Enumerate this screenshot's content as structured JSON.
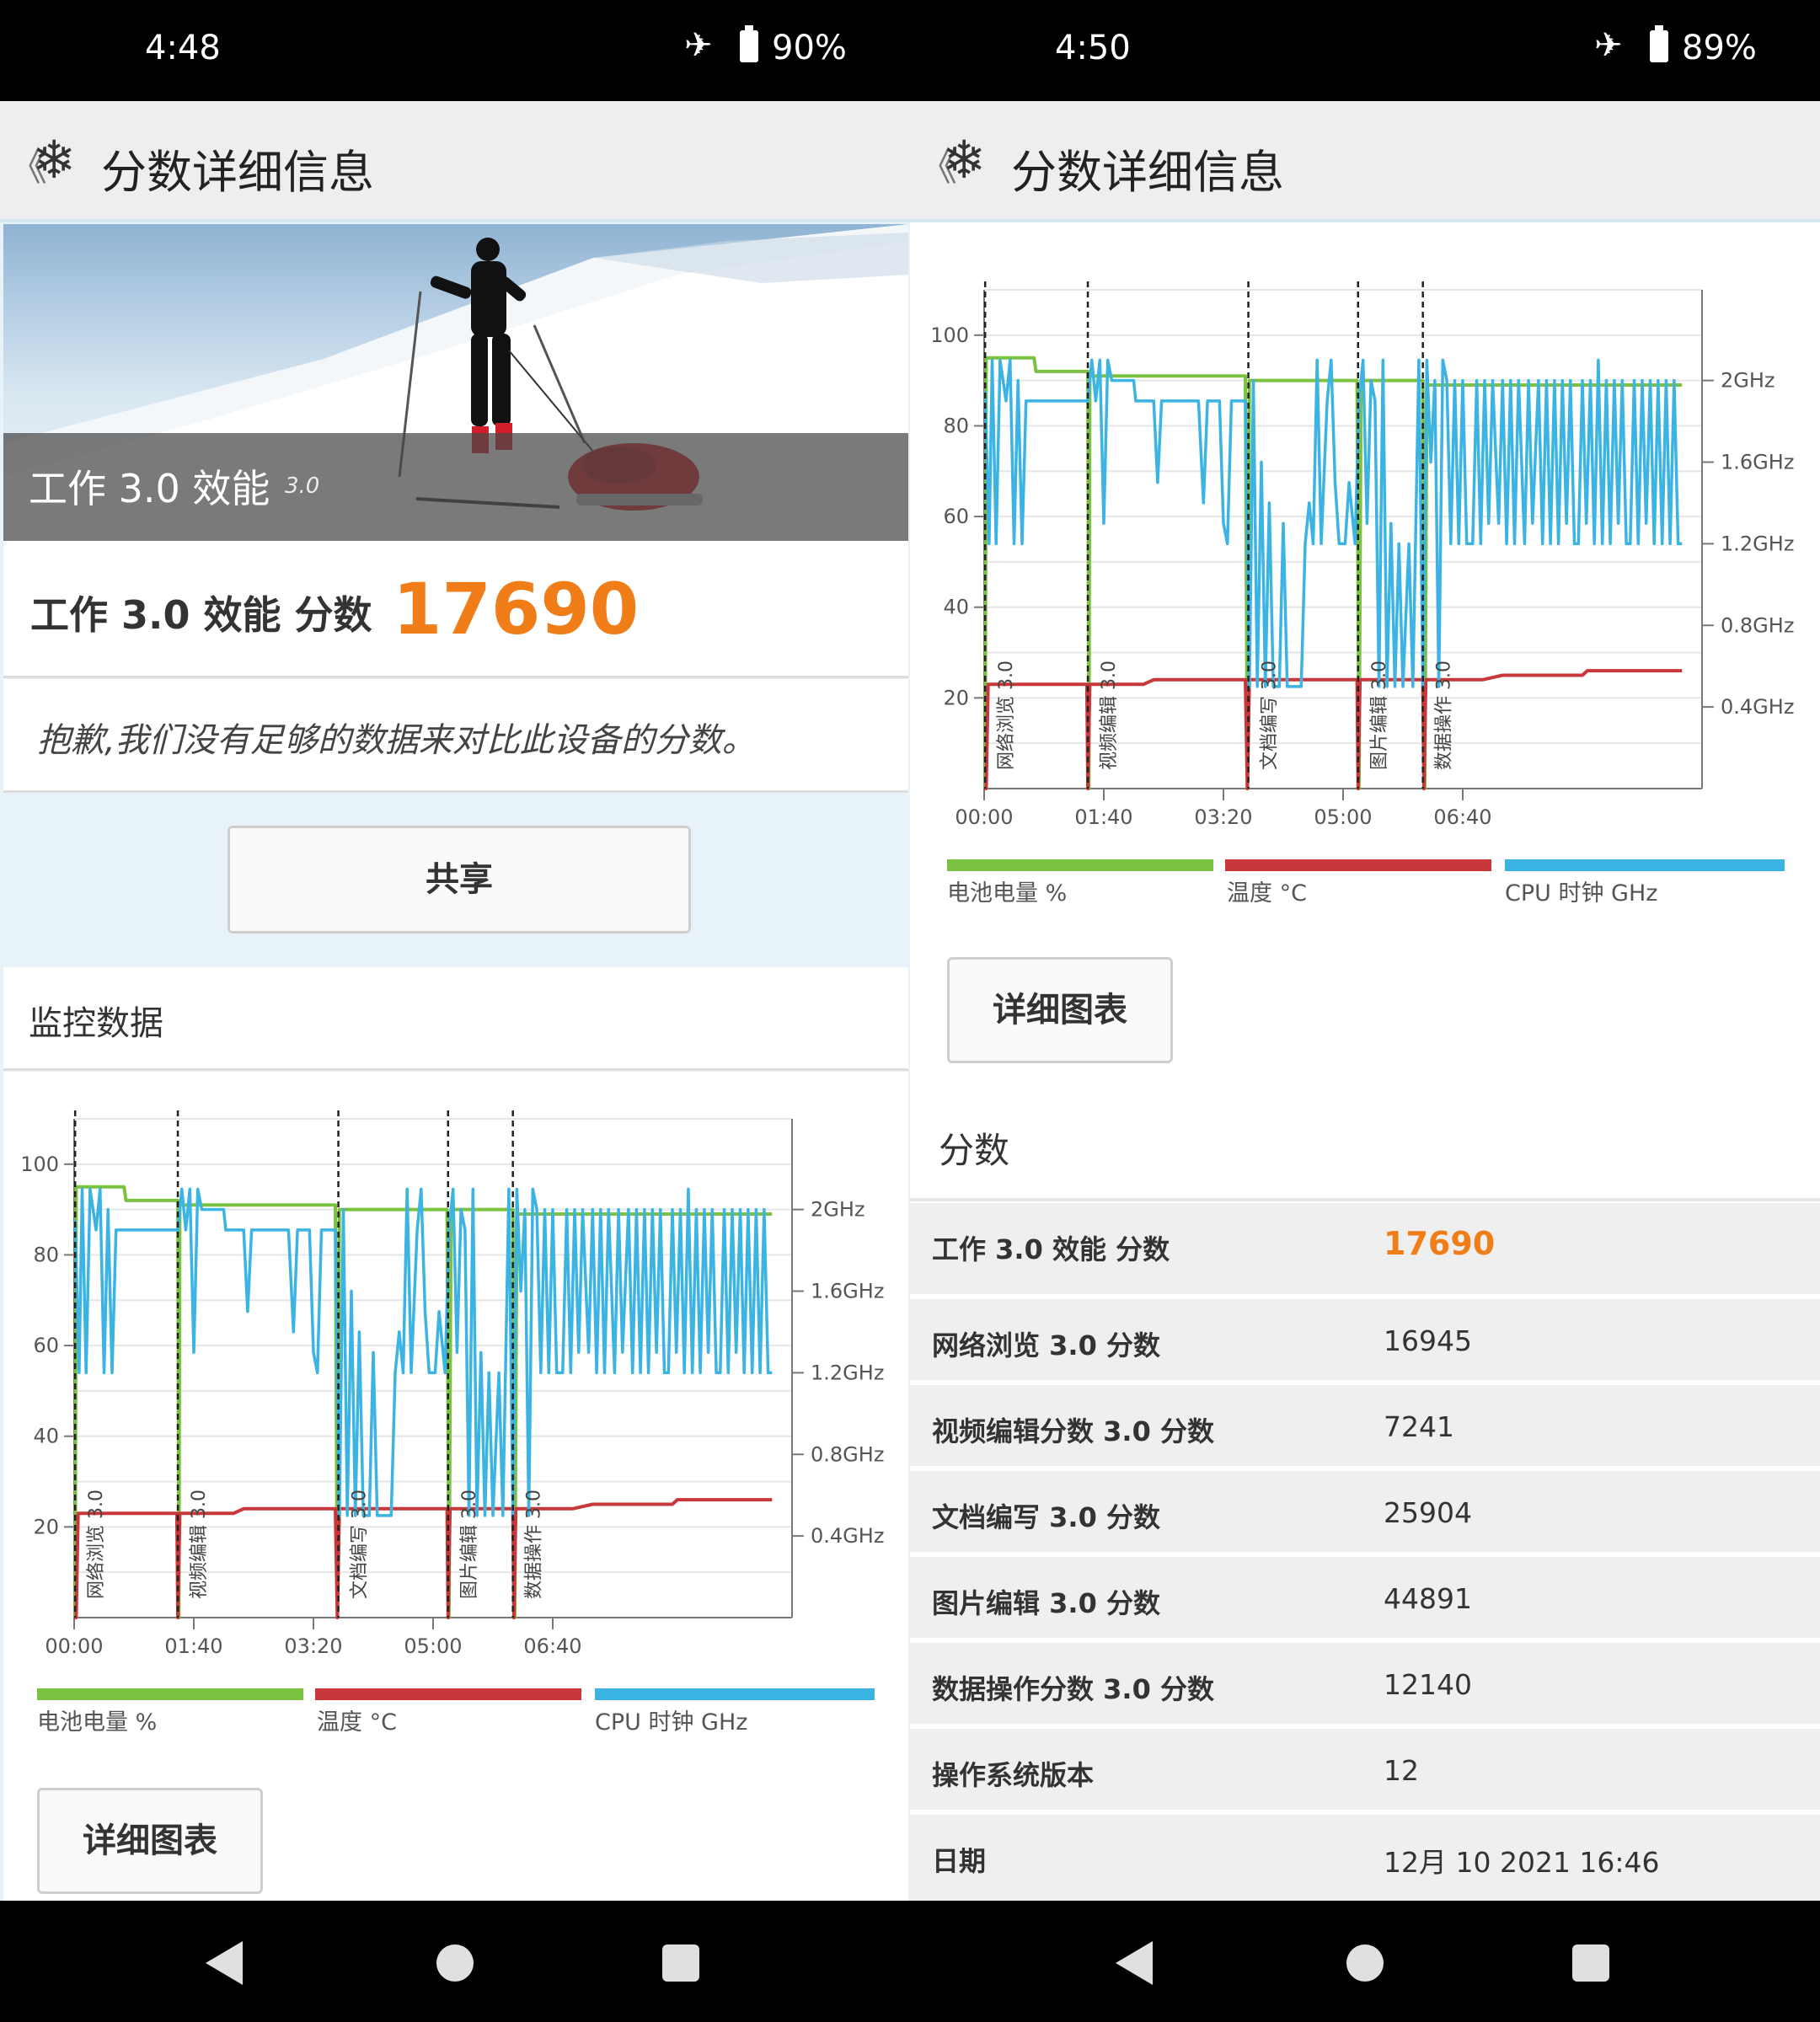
{
  "left": {
    "status": {
      "time": "4:48",
      "battery_pct": "90%"
    },
    "appbar": {
      "back": "《",
      "title": "分数详细信息"
    },
    "hero": {
      "title": "工作 3.0 效能",
      "version": "3.0"
    },
    "score": {
      "label": "工作 3.0 效能 分数",
      "value": "17690"
    },
    "notice": "抱歉,我们没有足够的数据来对比此设备的分数。",
    "share_button": "共享",
    "monitor": {
      "heading": "监控数据"
    },
    "details_button": "详细图表"
  },
  "right": {
    "status": {
      "time": "4:50",
      "battery_pct": "89%"
    },
    "appbar": {
      "back": "《",
      "title": "分数详细信息"
    },
    "details_button": "详细图表",
    "scores_heading": "分数",
    "rows": [
      {
        "label": "工作 3.0 效能 分数",
        "value": "17690"
      },
      {
        "label": "网络浏览 3.0 分数",
        "value": "16945"
      },
      {
        "label": "视频编辑分数 3.0 分数",
        "value": "7241"
      },
      {
        "label": "文档编写 3.0 分数",
        "value": "25904"
      },
      {
        "label": "图片编辑 3.0 分数",
        "value": "44891"
      },
      {
        "label": "数据操作分数 3.0 分数",
        "value": "12140"
      },
      {
        "label": "操作系统版本",
        "value": "12"
      },
      {
        "label": "日期",
        "value": "12月 10 2021 16:46"
      }
    ]
  },
  "colors": {
    "accent": "#f07d18",
    "battery": "#7cc242",
    "temp": "#c8383a",
    "cpu": "#3bb4e3"
  },
  "icons": {
    "logo": "snowflake-icon",
    "airplane": "airplane-icon",
    "battery": "battery-icon"
  },
  "chart_data": {
    "type": "line",
    "x_ticks": [
      "00:00",
      "01:40",
      "03:20",
      "05:00",
      "06:40"
    ],
    "y_ticks_left": [
      "100",
      "80",
      "60",
      "40",
      "20"
    ],
    "y_ticks_right": [
      "2GHz",
      "1.6GHz",
      "1.2GHz",
      "0.8GHz",
      "0.4GHz"
    ],
    "ylim_left": [
      0,
      110
    ],
    "markers": [
      {
        "t": 1,
        "label": "网络浏览 3.0"
      },
      {
        "t": 104,
        "label": "视频编辑 3.0"
      },
      {
        "t": 265,
        "label": "文档编写 3.0"
      },
      {
        "t": 375,
        "label": "图片编辑 3.0"
      },
      {
        "t": 440,
        "label": "数据操作 3.0"
      }
    ],
    "legend": [
      "电池电量 %",
      "温度 °C",
      "CPU 时钟 GHz"
    ],
    "series": [
      {
        "name": "电池电量 %",
        "points": [
          [
            0,
            0
          ],
          [
            1,
            0
          ],
          [
            2,
            95
          ],
          [
            20,
            95
          ],
          [
            50,
            95
          ],
          [
            52,
            92
          ],
          [
            104,
            92
          ],
          [
            105,
            0
          ],
          [
            106,
            91
          ],
          [
            160,
            91
          ],
          [
            262,
            91
          ],
          [
            264,
            0
          ],
          [
            266,
            90
          ],
          [
            300,
            90
          ],
          [
            374,
            90
          ],
          [
            376,
            0
          ],
          [
            378,
            90
          ],
          [
            440,
            90
          ],
          [
            442,
            0
          ],
          [
            444,
            89
          ],
          [
            700,
            89
          ]
        ]
      },
      {
        "name": "温度 °C",
        "points": [
          [
            0,
            0
          ],
          [
            2,
            0
          ],
          [
            4,
            23
          ],
          [
            100,
            23
          ],
          [
            103,
            23
          ],
          [
            104,
            0
          ],
          [
            106,
            23
          ],
          [
            160,
            23
          ],
          [
            170,
            24
          ],
          [
            262,
            24
          ],
          [
            264,
            0
          ],
          [
            266,
            24
          ],
          [
            300,
            24
          ],
          [
            374,
            24
          ],
          [
            375,
            0
          ],
          [
            377,
            24
          ],
          [
            440,
            24
          ],
          [
            441,
            0
          ],
          [
            443,
            24
          ],
          [
            500,
            24
          ],
          [
            520,
            25
          ],
          [
            580,
            25
          ],
          [
            600,
            25
          ],
          [
            605,
            26
          ],
          [
            700,
            26
          ]
        ]
      },
      {
        "name": "CPU 时钟 GHz",
        "points": [
          [
            1,
            1.95
          ],
          [
            5,
            1.2
          ],
          [
            8,
            2.1
          ],
          [
            12,
            1.2
          ],
          [
            16,
            2.1
          ],
          [
            22,
            1.9
          ],
          [
            26,
            2.1
          ],
          [
            30,
            1.2
          ],
          [
            34,
            2.0
          ],
          [
            38,
            1.2
          ],
          [
            42,
            1.9
          ],
          [
            46,
            1.9
          ],
          [
            104,
            1.9
          ],
          [
            108,
            2.1
          ],
          [
            112,
            1.9
          ],
          [
            116,
            2.1
          ],
          [
            120,
            1.3
          ],
          [
            124,
            2.1
          ],
          [
            128,
            2.0
          ],
          [
            150,
            2.0
          ],
          [
            152,
            1.9
          ],
          [
            170,
            1.9
          ],
          [
            174,
            1.5
          ],
          [
            178,
            1.9
          ],
          [
            200,
            1.9
          ],
          [
            215,
            1.9
          ],
          [
            220,
            1.4
          ],
          [
            224,
            1.9
          ],
          [
            236,
            1.9
          ],
          [
            240,
            1.3
          ],
          [
            244,
            1.2
          ],
          [
            248,
            1.9
          ],
          [
            262,
            1.9
          ],
          [
            266,
            0.5
          ],
          [
            270,
            2.0
          ],
          [
            274,
            0.5
          ],
          [
            278,
            1.6
          ],
          [
            282,
            0.5
          ],
          [
            286,
            1.4
          ],
          [
            290,
            0.5
          ],
          [
            296,
            0.5
          ],
          [
            300,
            1.3
          ],
          [
            304,
            0.5
          ],
          [
            318,
            0.5
          ],
          [
            322,
            1.2
          ],
          [
            326,
            1.4
          ],
          [
            330,
            1.2
          ],
          [
            334,
            2.1
          ],
          [
            338,
            1.2
          ],
          [
            344,
            1.9
          ],
          [
            348,
            2.1
          ],
          [
            352,
            1.5
          ],
          [
            356,
            1.2
          ],
          [
            362,
            1.2
          ],
          [
            366,
            1.5
          ],
          [
            372,
            1.2
          ],
          [
            376,
            1.9
          ],
          [
            380,
            2.1
          ],
          [
            384,
            1.3
          ],
          [
            388,
            2.0
          ],
          [
            392,
            1.9
          ],
          [
            396,
            0.5
          ],
          [
            400,
            2.1
          ],
          [
            404,
            0.5
          ],
          [
            408,
            1.3
          ],
          [
            412,
            0.5
          ],
          [
            416,
            1.2
          ],
          [
            420,
            0.5
          ],
          [
            426,
            1.2
          ],
          [
            430,
            0.5
          ],
          [
            436,
            2.1
          ],
          [
            440,
            0.5
          ],
          [
            444,
            2.1
          ],
          [
            448,
            1.6
          ],
          [
            452,
            2.0
          ],
          [
            456,
            0.5
          ],
          [
            460,
            2.1
          ],
          [
            464,
            2.0
          ],
          [
            468,
            1.2
          ],
          [
            472,
            2.0
          ],
          [
            476,
            1.2
          ],
          [
            480,
            2.0
          ],
          [
            484,
            1.2
          ],
          [
            490,
            1.2
          ],
          [
            494,
            2.0
          ],
          [
            498,
            1.2
          ],
          [
            502,
            2.0
          ],
          [
            506,
            1.3
          ],
          [
            510,
            2.0
          ],
          [
            516,
            1.3
          ],
          [
            520,
            2.0
          ],
          [
            524,
            1.2
          ],
          [
            528,
            2.0
          ],
          [
            532,
            1.2
          ],
          [
            536,
            2.0
          ],
          [
            542,
            1.2
          ],
          [
            546,
            2.0
          ],
          [
            550,
            1.3
          ],
          [
            556,
            2.0
          ],
          [
            560,
            1.2
          ],
          [
            564,
            2.0
          ],
          [
            568,
            1.2
          ],
          [
            572,
            2.0
          ],
          [
            576,
            1.2
          ],
          [
            580,
            2.0
          ],
          [
            584,
            1.3
          ],
          [
            588,
            2.0
          ],
          [
            592,
            1.2
          ],
          [
            596,
            1.2
          ],
          [
            600,
            2.0
          ],
          [
            604,
            1.3
          ],
          [
            608,
            2.0
          ],
          [
            612,
            1.2
          ],
          [
            616,
            2.1
          ],
          [
            620,
            1.2
          ],
          [
            624,
            2.0
          ],
          [
            628,
            1.2
          ],
          [
            632,
            2.0
          ],
          [
            636,
            1.3
          ],
          [
            640,
            2.0
          ],
          [
            644,
            1.2
          ],
          [
            648,
            1.2
          ],
          [
            652,
            2.0
          ],
          [
            656,
            1.2
          ],
          [
            660,
            2.0
          ],
          [
            664,
            1.3
          ],
          [
            668,
            2.0
          ],
          [
            672,
            1.2
          ],
          [
            676,
            2.0
          ],
          [
            680,
            1.2
          ],
          [
            684,
            2.0
          ],
          [
            688,
            1.2
          ],
          [
            692,
            2.0
          ],
          [
            696,
            1.2
          ],
          [
            700,
            1.2
          ]
        ]
      }
    ]
  }
}
